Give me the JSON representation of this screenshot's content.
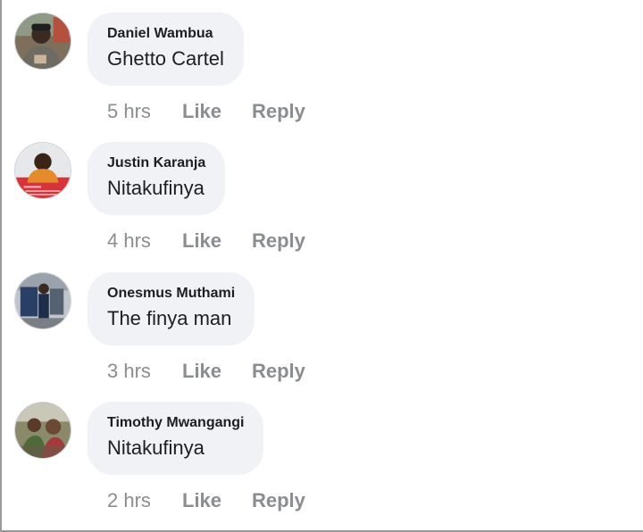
{
  "comments": [
    {
      "author": "Daniel Wambua",
      "text": "Ghetto Cartel",
      "time": "5 hrs",
      "like": "Like",
      "reply": "Reply"
    },
    {
      "author": "Justin Karanja",
      "text": "Nitakufinya",
      "time": "4 hrs",
      "like": "Like",
      "reply": "Reply"
    },
    {
      "author": "Onesmus Muthami",
      "text": "The finya man",
      "time": "3 hrs",
      "like": "Like",
      "reply": "Reply"
    },
    {
      "author": "Timothy Mwangangi",
      "text": "Nitakufinya",
      "time": "2 hrs",
      "like": "Like",
      "reply": "Reply"
    }
  ],
  "colors": {
    "bubble": "#f0f2f5",
    "text": "#1c1e21",
    "meta": "#8a8d91"
  }
}
